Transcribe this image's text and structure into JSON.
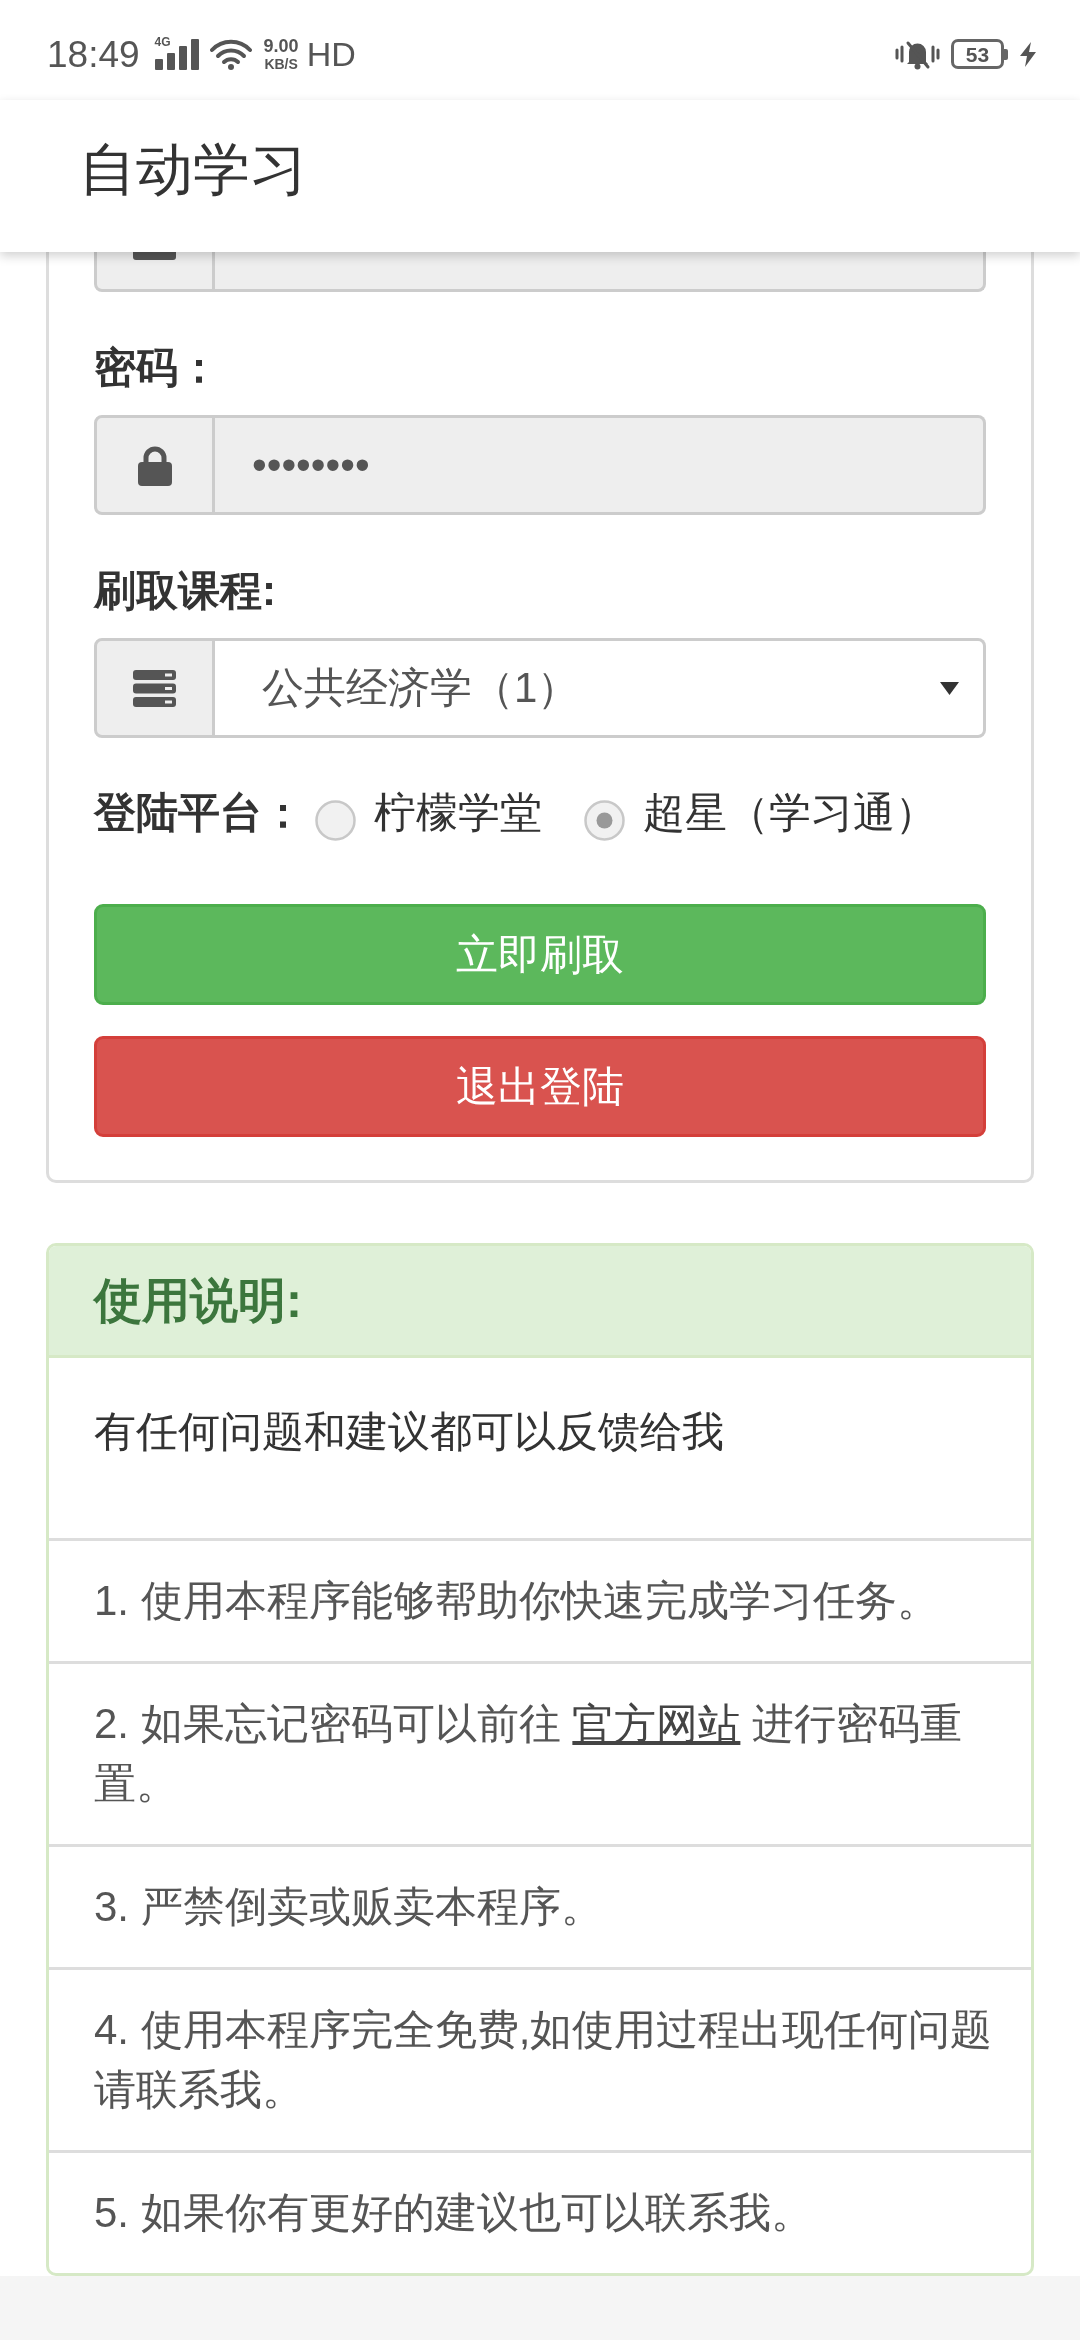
{
  "status_bar": {
    "time": "18:49",
    "network": "4G",
    "speed": "9.00",
    "speed_unit": "KB/S",
    "hd_indicator": "HD",
    "battery": "53"
  },
  "app_bar": {
    "title": "自动学习"
  },
  "form": {
    "fields": [
      {
        "kind": "username"
      },
      {
        "kind": "password",
        "label": "密码：",
        "value": "••••••••"
      },
      {
        "kind": "select",
        "label": "刷取课程:",
        "value": "公共经济学（1）"
      }
    ],
    "platform": {
      "label": "登陆平台：",
      "options": [
        {
          "label": "柠檬学堂",
          "selected": false
        },
        {
          "label": "超星（学习通）",
          "selected": true
        }
      ]
    },
    "buttons": [
      {
        "label": "立即刷取",
        "kind": "success"
      },
      {
        "label": "退出登陆",
        "kind": "danger"
      }
    ]
  },
  "instructions": {
    "title": "使用说明:",
    "items": [
      {
        "kind": "intro",
        "text": "有任何问题和建议都可以反馈给我"
      },
      {
        "kind": "rule",
        "text": "1. 使用本程序能够帮助你快速完成学习任务。"
      },
      {
        "kind": "rule",
        "text": "2. 如果忘记密码可以前往 ",
        "link": "官方网站",
        "text_after": " 进行密码重置。"
      },
      {
        "kind": "rule",
        "text": "3. 严禁倒卖或贩卖本程序。"
      },
      {
        "kind": "rule",
        "text": "4. 使用本程序完全免费,如使用过程出现任何问题请联系我。"
      },
      {
        "kind": "rule",
        "text": "5. 如果你有更好的建议也可以联系我。"
      }
    ]
  }
}
